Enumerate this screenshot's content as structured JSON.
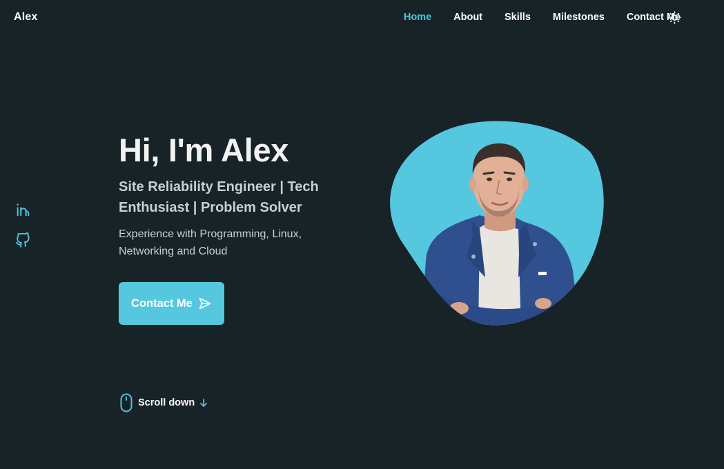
{
  "header": {
    "logo": "Alex",
    "nav": [
      "Home",
      "About",
      "Skills",
      "Milestones",
      "Contact Me"
    ],
    "active_nav": "Home",
    "theme_icon": "sun-icon"
  },
  "social": {
    "icons": [
      "linkedin-icon",
      "github-icon"
    ]
  },
  "hero": {
    "title": "Hi, I'm Alex",
    "subtitle": "Site Reliability Engineer | Tech Enthusiast | Problem Solver",
    "description": "Experience with Programming, Linux, Networking and Cloud",
    "contact_button": "Contact Me",
    "contact_icon": "send-icon",
    "scroll_label": "Scroll down",
    "scroll_icons": [
      "mouse-icon",
      "arrow-down-icon"
    ]
  },
  "colors": {
    "background": "#182328",
    "accent": "#55c7df",
    "text": "#ffffff",
    "muted_text": "#c9cfd2"
  }
}
